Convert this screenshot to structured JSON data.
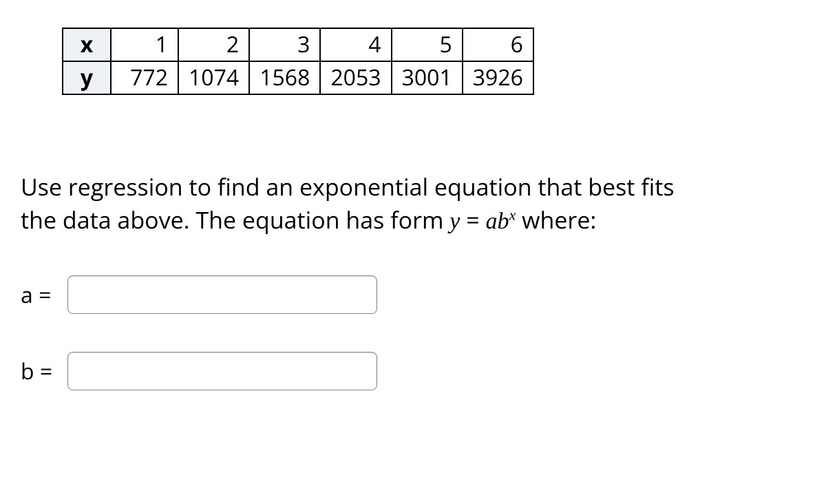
{
  "table": {
    "rowHeaders": [
      "x",
      "y"
    ],
    "x": [
      "1",
      "2",
      "3",
      "4",
      "5",
      "6"
    ],
    "y": [
      "772",
      "1074",
      "1568",
      "2053",
      "3001",
      "3926"
    ]
  },
  "prompt": {
    "line1": "Use regression to find an exponential equation that best fits",
    "line2_pre": "the data above. The equation has form ",
    "eq_y": "y",
    "eq_eq": " = ",
    "eq_ab": "ab",
    "eq_exp": "x",
    "line2_post": " where:"
  },
  "fields": {
    "a_label": "a =",
    "a_value": "",
    "b_label": "b =",
    "b_value": ""
  }
}
